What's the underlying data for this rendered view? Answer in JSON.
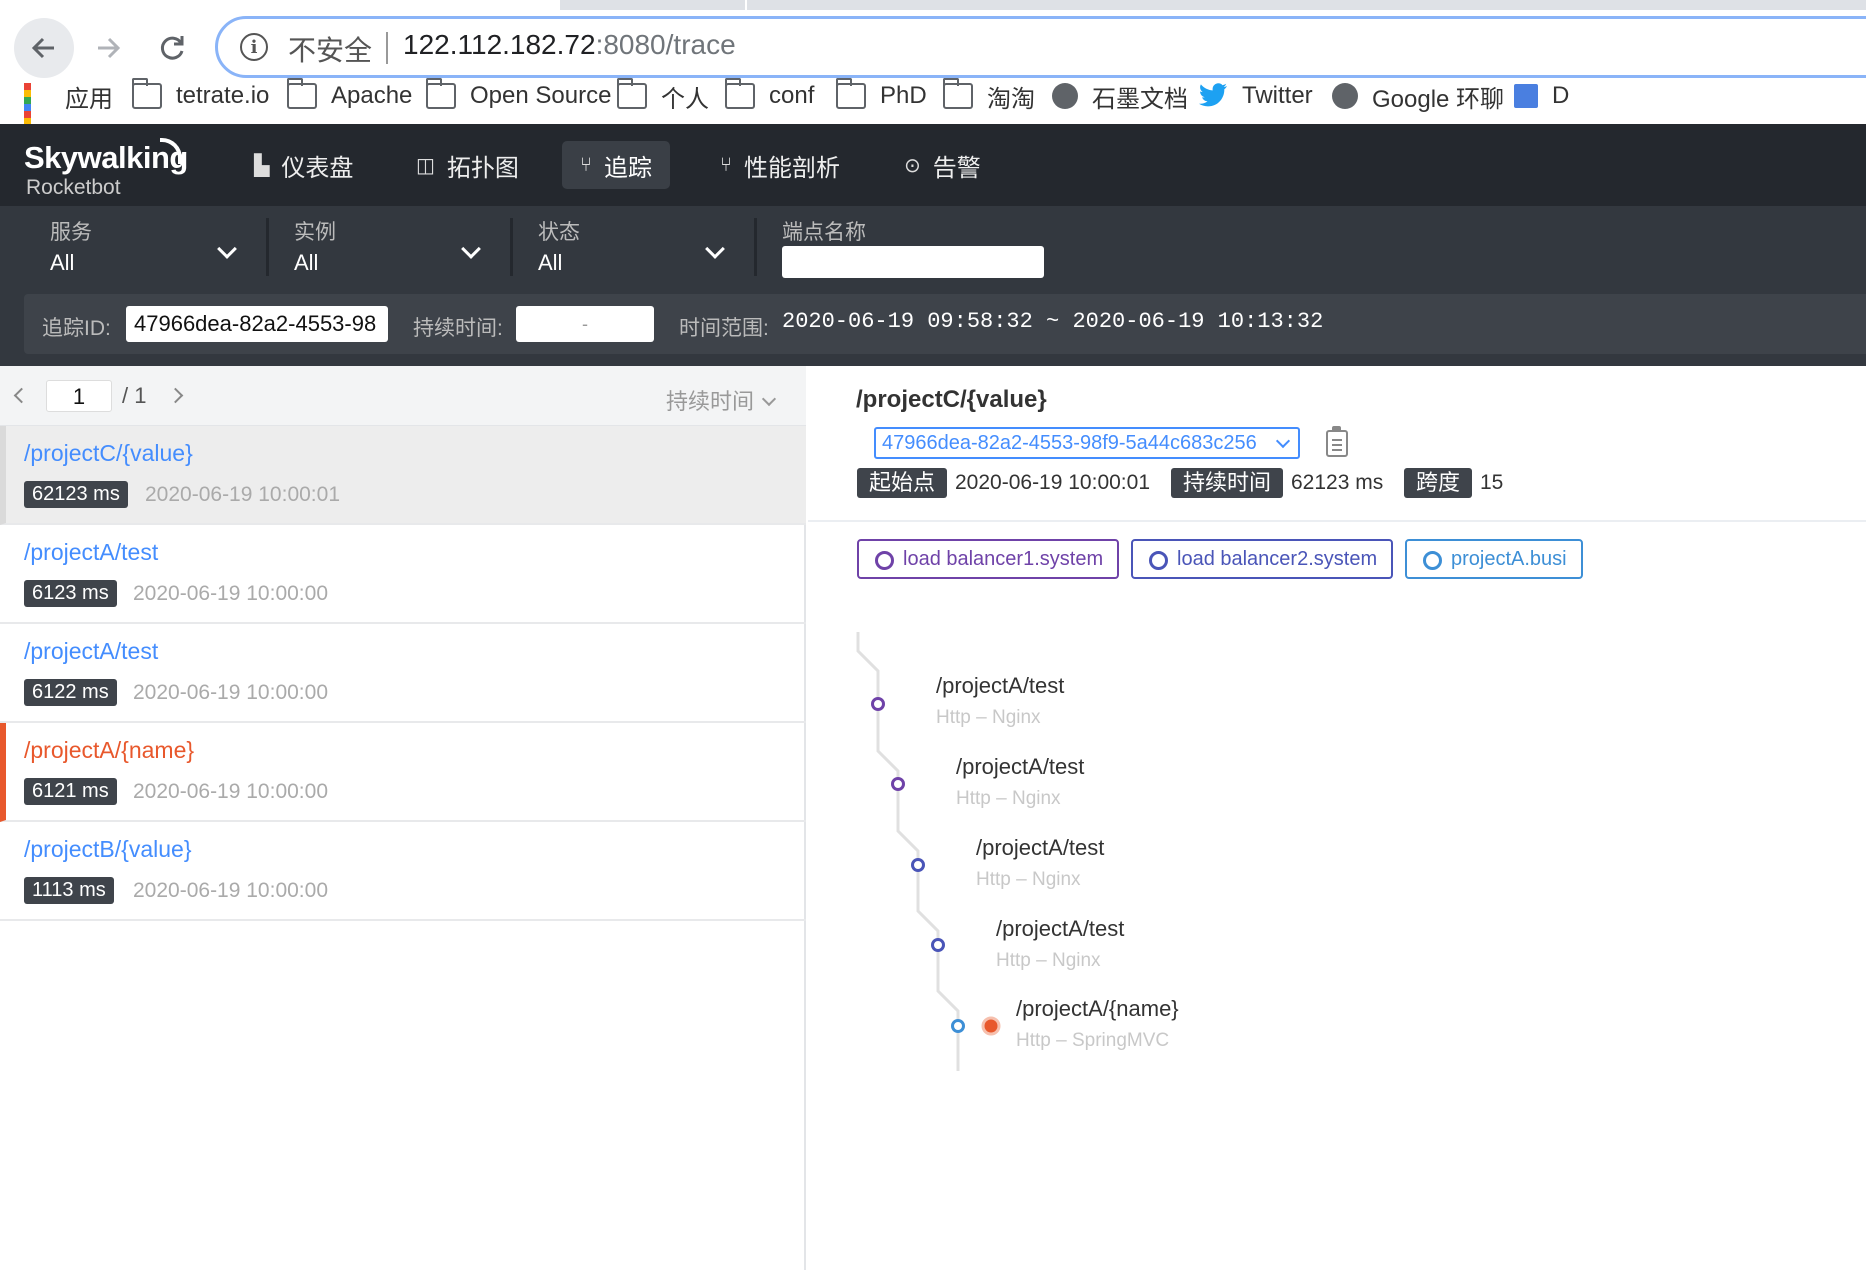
{
  "browser": {
    "security_label": "不安全",
    "url_host": "122.112.182.72",
    "url_path": ":8080/trace",
    "bookmarks": [
      {
        "label": "应用",
        "icon": "apps-grid-icon"
      },
      {
        "label": "tetrate.io",
        "icon": "folder-icon"
      },
      {
        "label": "Apache",
        "icon": "folder-icon"
      },
      {
        "label": "Open Source",
        "icon": "folder-icon"
      },
      {
        "label": "个人",
        "icon": "folder-icon"
      },
      {
        "label": "conf",
        "icon": "folder-icon"
      },
      {
        "label": "PhD",
        "icon": "folder-icon"
      },
      {
        "label": "淘淘",
        "icon": "folder-icon"
      },
      {
        "label": "石墨文档",
        "icon": "globe-icon"
      },
      {
        "label": "Twitter",
        "icon": "twitter-icon"
      },
      {
        "label": "Google 环聊",
        "icon": "globe-icon"
      },
      {
        "label": "D",
        "icon": "bookmark-icon"
      }
    ]
  },
  "app": {
    "logo": "Skywalking",
    "logo_sub": "Rocketbot",
    "nav": [
      {
        "label": "仪表盘",
        "icon": "chart-icon"
      },
      {
        "label": "拓扑图",
        "icon": "topology-icon"
      },
      {
        "label": "追踪",
        "icon": "trace-icon",
        "active": true
      },
      {
        "label": "性能剖析",
        "icon": "profile-icon"
      },
      {
        "label": "告警",
        "icon": "alarm-icon"
      }
    ]
  },
  "filters": {
    "service": {
      "label": "服务",
      "value": "All"
    },
    "instance": {
      "label": "实例",
      "value": "All"
    },
    "status": {
      "label": "状态",
      "value": "All"
    },
    "endpoint": {
      "label": "端点名称",
      "value": ""
    },
    "trace_id_label": "追踪ID:",
    "trace_id_value": "47966dea-82a2-4553-98",
    "duration_label": "持续时间:",
    "duration_value": "-",
    "time_range_label": "时间范围:",
    "time_range_value": "2020-06-19 09:58:32 ~ 2020-06-19 10:13:32"
  },
  "list": {
    "page": "1",
    "total_pages": "/ 1",
    "sort_label": "持续时间",
    "traces": [
      {
        "endpoint": "/projectC/{value}",
        "duration": "62123 ms",
        "time": "2020-06-19 10:00:01",
        "selected": true,
        "error": false
      },
      {
        "endpoint": "/projectA/test",
        "duration": "6123 ms",
        "time": "2020-06-19 10:00:00",
        "selected": false,
        "error": false
      },
      {
        "endpoint": "/projectA/test",
        "duration": "6122 ms",
        "time": "2020-06-19 10:00:00",
        "selected": false,
        "error": false
      },
      {
        "endpoint": "/projectA/{name}",
        "duration": "6121 ms",
        "time": "2020-06-19 10:00:00",
        "selected": false,
        "error": true
      },
      {
        "endpoint": "/projectB/{value}",
        "duration": "1113 ms",
        "time": "2020-06-19 10:00:00",
        "selected": false,
        "error": false
      }
    ]
  },
  "detail": {
    "title": "/projectC/{value}",
    "trace_id": "47966dea-82a2-4553-98f9-5a44c683c256",
    "start_label": "起始点",
    "start_value": "2020-06-19 10:00:01",
    "duration_label": "持续时间",
    "duration_value": "62123 ms",
    "spans_label": "跨度",
    "spans_value": "15",
    "services": [
      {
        "name": "load balancer1.system",
        "color": "#6f42a8"
      },
      {
        "name": "load balancer2.system",
        "color": "#4a55b8"
      },
      {
        "name": "projectA.busi",
        "color": "#3d8fd6"
      }
    ],
    "spans": [
      {
        "endpoint": "/projectA/test",
        "component": "Http – Nginx",
        "color": "#6f42a8"
      },
      {
        "endpoint": "/projectA/test",
        "component": "Http – Nginx",
        "color": "#6f42a8"
      },
      {
        "endpoint": "/projectA/test",
        "component": "Http – Nginx",
        "color": "#4a55b8"
      },
      {
        "endpoint": "/projectA/test",
        "component": "Http – Nginx",
        "color": "#4a55b8"
      },
      {
        "endpoint": "/projectA/{name}",
        "component": "Http – SpringMVC",
        "color": "#3d8fd6",
        "error_color": "#e8582c"
      }
    ]
  }
}
